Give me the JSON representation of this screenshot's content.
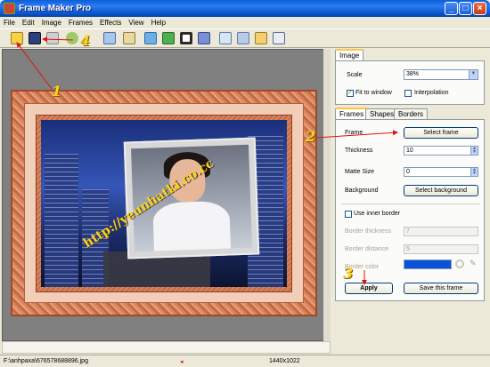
{
  "window": {
    "title": "Frame Maker Pro"
  },
  "menu": [
    "File",
    "Edit",
    "Image",
    "Frames",
    "Effects",
    "View",
    "Help"
  ],
  "toolbar": [
    "open-icon",
    "save-icon",
    "print-icon",
    "undo-icon",
    "copy-icon",
    "paste-icon",
    "image-icon",
    "picture-icon",
    "frame-icon",
    "brush-icon",
    "crop-icon",
    "export-icon",
    "text-icon",
    "document-icon"
  ],
  "canvas": {
    "watermark": "http://yeunhatki.co.cc"
  },
  "annotations": {
    "m1": "1",
    "m2": "2",
    "m3": "3",
    "m4": "4"
  },
  "image_panel": {
    "tab": "Image",
    "scale_label": "Scale",
    "scale_value": "38%",
    "fit_to_window": "Fit to window",
    "fit_checked": true,
    "interpolation": "Interpolation",
    "interpolation_checked": false
  },
  "frame_panel": {
    "tabs": [
      "Frames",
      "Shapes",
      "Borders"
    ],
    "frame_label": "Frame",
    "select_frame": "Select frame",
    "thickness_label": "Thickness",
    "thickness_value": "10",
    "matte_label": "Matte Size",
    "matte_value": "0",
    "background_label": "Background",
    "select_background": "Select background",
    "use_inner_border": "Use inner border",
    "border_thickness_label": "Border thickness",
    "border_thickness_value": "7",
    "border_distance_label": "Border distance",
    "border_distance_value": "5",
    "border_color_label": "Border color",
    "border_color": "#0a52d8",
    "apply": "Apply",
    "save_frame": "Save this frame"
  },
  "status": {
    "path": "F:\\anhpaxa\\676578688896.jpg",
    "size": "1440x1022"
  }
}
